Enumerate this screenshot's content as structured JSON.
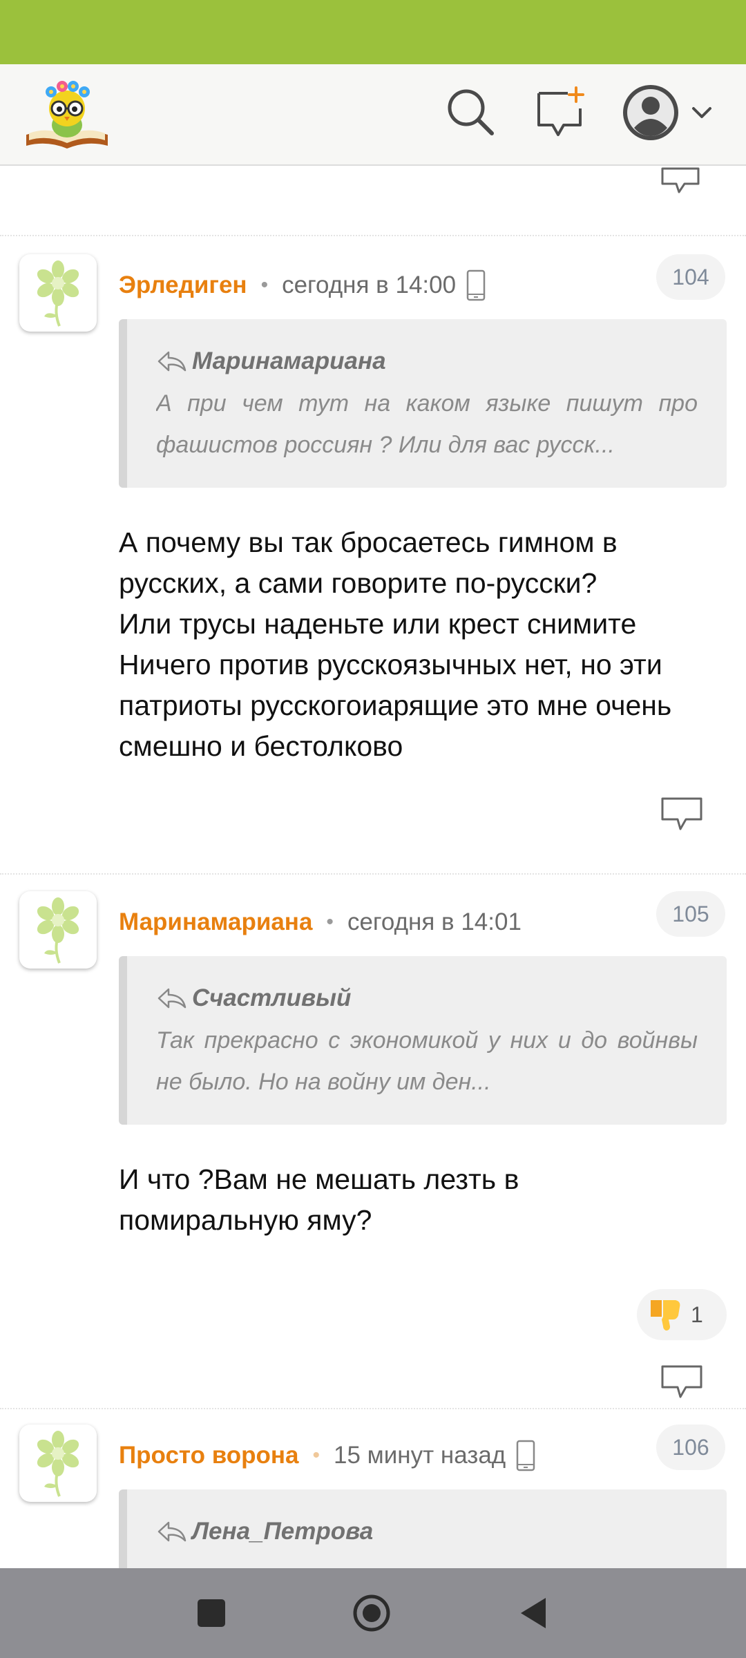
{
  "colors": {
    "status_bar": "#9bc13c",
    "author": "#e8800f",
    "badge_text": "#7f8a99",
    "quote_bg": "#efefef"
  },
  "header": {
    "logo_icon": "owl-book-logo",
    "search_icon": "search-icon",
    "new_post_icon": "new-message-icon",
    "profile_icon": "user-avatar-icon"
  },
  "comments": [
    {
      "author": "Эрледиген",
      "time": "сегодня в 14:00",
      "device": "mobile",
      "number": "104",
      "quote": {
        "author": "Маринамариана",
        "text": "А при чем тут на каком языке пишут про фашистов россиян ? Или для вас русск..."
      },
      "body": [
        "А почему вы так бросаетесь гимном в",
        "русских, а сами говорите по-русски?",
        "Или трусы наденьте или крест снимите",
        "Ничего против русскоязычных нет, но эти",
        "патриоты русскогоиарящие это мне очень",
        "смешно и бестолково"
      ]
    },
    {
      "author": "Маринамариана",
      "time": "сегодня в 14:01",
      "number": "105",
      "quote": {
        "author": "Счастливый",
        "text": "Так прекрасно с экономикой у них и до войнвы не было. Но на войну им ден..."
      },
      "body": [
        "И что ?Вам не мешать лезть в",
        "помиральную яму?"
      ],
      "reaction": {
        "icon": "thumbs-down-icon",
        "count": "1"
      }
    },
    {
      "author": "Просто ворона",
      "time": "15 минут назад",
      "device": "mobile",
      "number": "106",
      "quote": {
        "author": "Лена_Петрова",
        "text": ""
      }
    }
  ]
}
